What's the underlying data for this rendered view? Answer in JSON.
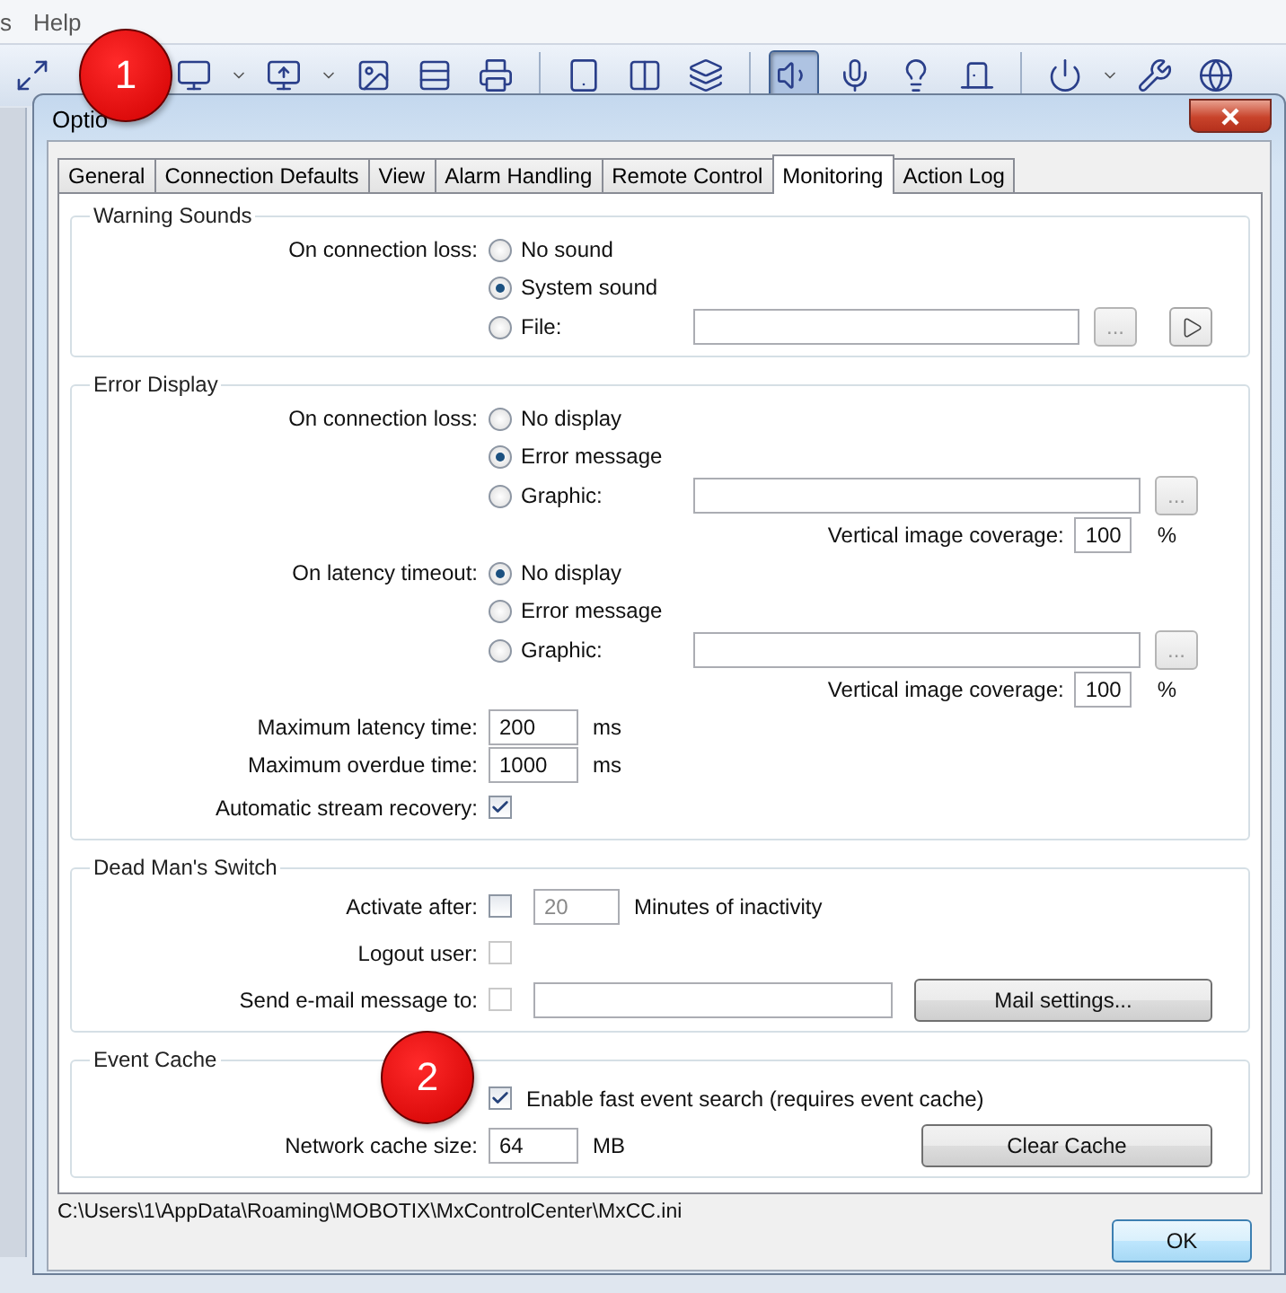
{
  "menu": [
    "s",
    "Help"
  ],
  "toolbar": [
    {
      "kind": "windows",
      "selected": false
    },
    {
      "kind": "monitor",
      "selected": false
    },
    {
      "kind": "caret"
    },
    {
      "kind": "import",
      "selected": false
    },
    {
      "kind": "caret"
    },
    {
      "kind": "frame",
      "selected": false
    },
    {
      "kind": "ladder",
      "selected": false
    },
    {
      "kind": "printer",
      "selected": false
    },
    {
      "kind": "sep"
    },
    {
      "kind": "tablet",
      "selected": false
    },
    {
      "kind": "split",
      "selected": false
    },
    {
      "kind": "stack",
      "selected": false
    },
    {
      "kind": "sep"
    },
    {
      "kind": "speaker",
      "selected": true
    },
    {
      "kind": "mic",
      "selected": false
    },
    {
      "kind": "bulb",
      "selected": false
    },
    {
      "kind": "door",
      "selected": false
    },
    {
      "kind": "sep"
    },
    {
      "kind": "power",
      "selected": false
    },
    {
      "kind": "caret"
    },
    {
      "kind": "wrench",
      "selected": false
    },
    {
      "kind": "globe",
      "selected": false
    }
  ],
  "dialog": {
    "title": "Optio",
    "tabs": [
      {
        "label": "General",
        "selected": false
      },
      {
        "label": "Connection Defaults",
        "selected": false
      },
      {
        "label": "View",
        "selected": false
      },
      {
        "label": "Alarm Handling",
        "selected": false
      },
      {
        "label": "Remote Control",
        "selected": false
      },
      {
        "label": "Monitoring",
        "selected": true
      },
      {
        "label": "Action Log",
        "selected": false
      }
    ],
    "groups": [
      {
        "title": "Warning Sounds",
        "rows": [
          {
            "kind": "radio",
            "label": "On connection loss:",
            "text": "No sound",
            "selected": false
          },
          {
            "kind": "radio",
            "text": "System sound",
            "selected": true
          },
          {
            "kind": "radio",
            "text": "File:",
            "selected": false,
            "field": true,
            "browse": "...",
            "play": true
          }
        ]
      },
      {
        "title": "Error Display",
        "rows": [
          {
            "kind": "radio",
            "label": "On connection loss:",
            "text": "No display",
            "selected": false
          },
          {
            "kind": "radio",
            "text": "Error message",
            "selected": true
          },
          {
            "kind": "radio",
            "text": "Graphic:",
            "selected": false,
            "field": true,
            "browse": "..."
          },
          {
            "kind": "coverage",
            "label": "Vertical image coverage:",
            "value": "100",
            "unit": "%"
          },
          {
            "kind": "radio",
            "label": "On latency timeout:",
            "text": "No display",
            "selected": true
          },
          {
            "kind": "radio",
            "text": "Error message",
            "selected": false
          },
          {
            "kind": "radio",
            "text": "Graphic:",
            "selected": false,
            "field": true,
            "browse": "..."
          },
          {
            "kind": "coverage",
            "label": "Vertical image coverage:",
            "value": "100",
            "unit": "%"
          },
          {
            "kind": "number",
            "label": "Maximum latency time:",
            "value": "200",
            "unit": "ms"
          },
          {
            "kind": "number",
            "label": "Maximum overdue time:",
            "value": "1000",
            "unit": "ms"
          },
          {
            "kind": "check",
            "label": "Automatic stream recovery:",
            "checked": true,
            "disabled": false
          }
        ]
      },
      {
        "title": "Dead Man's Switch",
        "rows": [
          {
            "kind": "check",
            "label": "Activate after:",
            "checked": false,
            "disabled": false,
            "value": "20",
            "text": "Minutes of inactivity"
          },
          {
            "kind": "check",
            "label": "Logout user:",
            "checked": false,
            "disabled": true
          },
          {
            "kind": "check",
            "label": "Send e-mail message to:",
            "checked": false,
            "disabled": true,
            "field": true,
            "button": "Mail settings..."
          }
        ]
      },
      {
        "title": "Event Cache",
        "rows": [
          {
            "kind": "check",
            "checked": true,
            "disabled": false,
            "text": "Enable fast event search (requires event cache)"
          },
          {
            "kind": "number",
            "label": "Network cache size:",
            "value": "64",
            "unit": "MB",
            "button": "Clear Cache"
          }
        ]
      }
    ],
    "path": "C:\\Users\\1\\AppData\\Roaming\\MOBOTIX\\MxControlCenter\\MxCC.ini",
    "ok": "OK"
  },
  "callouts": [
    "1",
    "2"
  ]
}
